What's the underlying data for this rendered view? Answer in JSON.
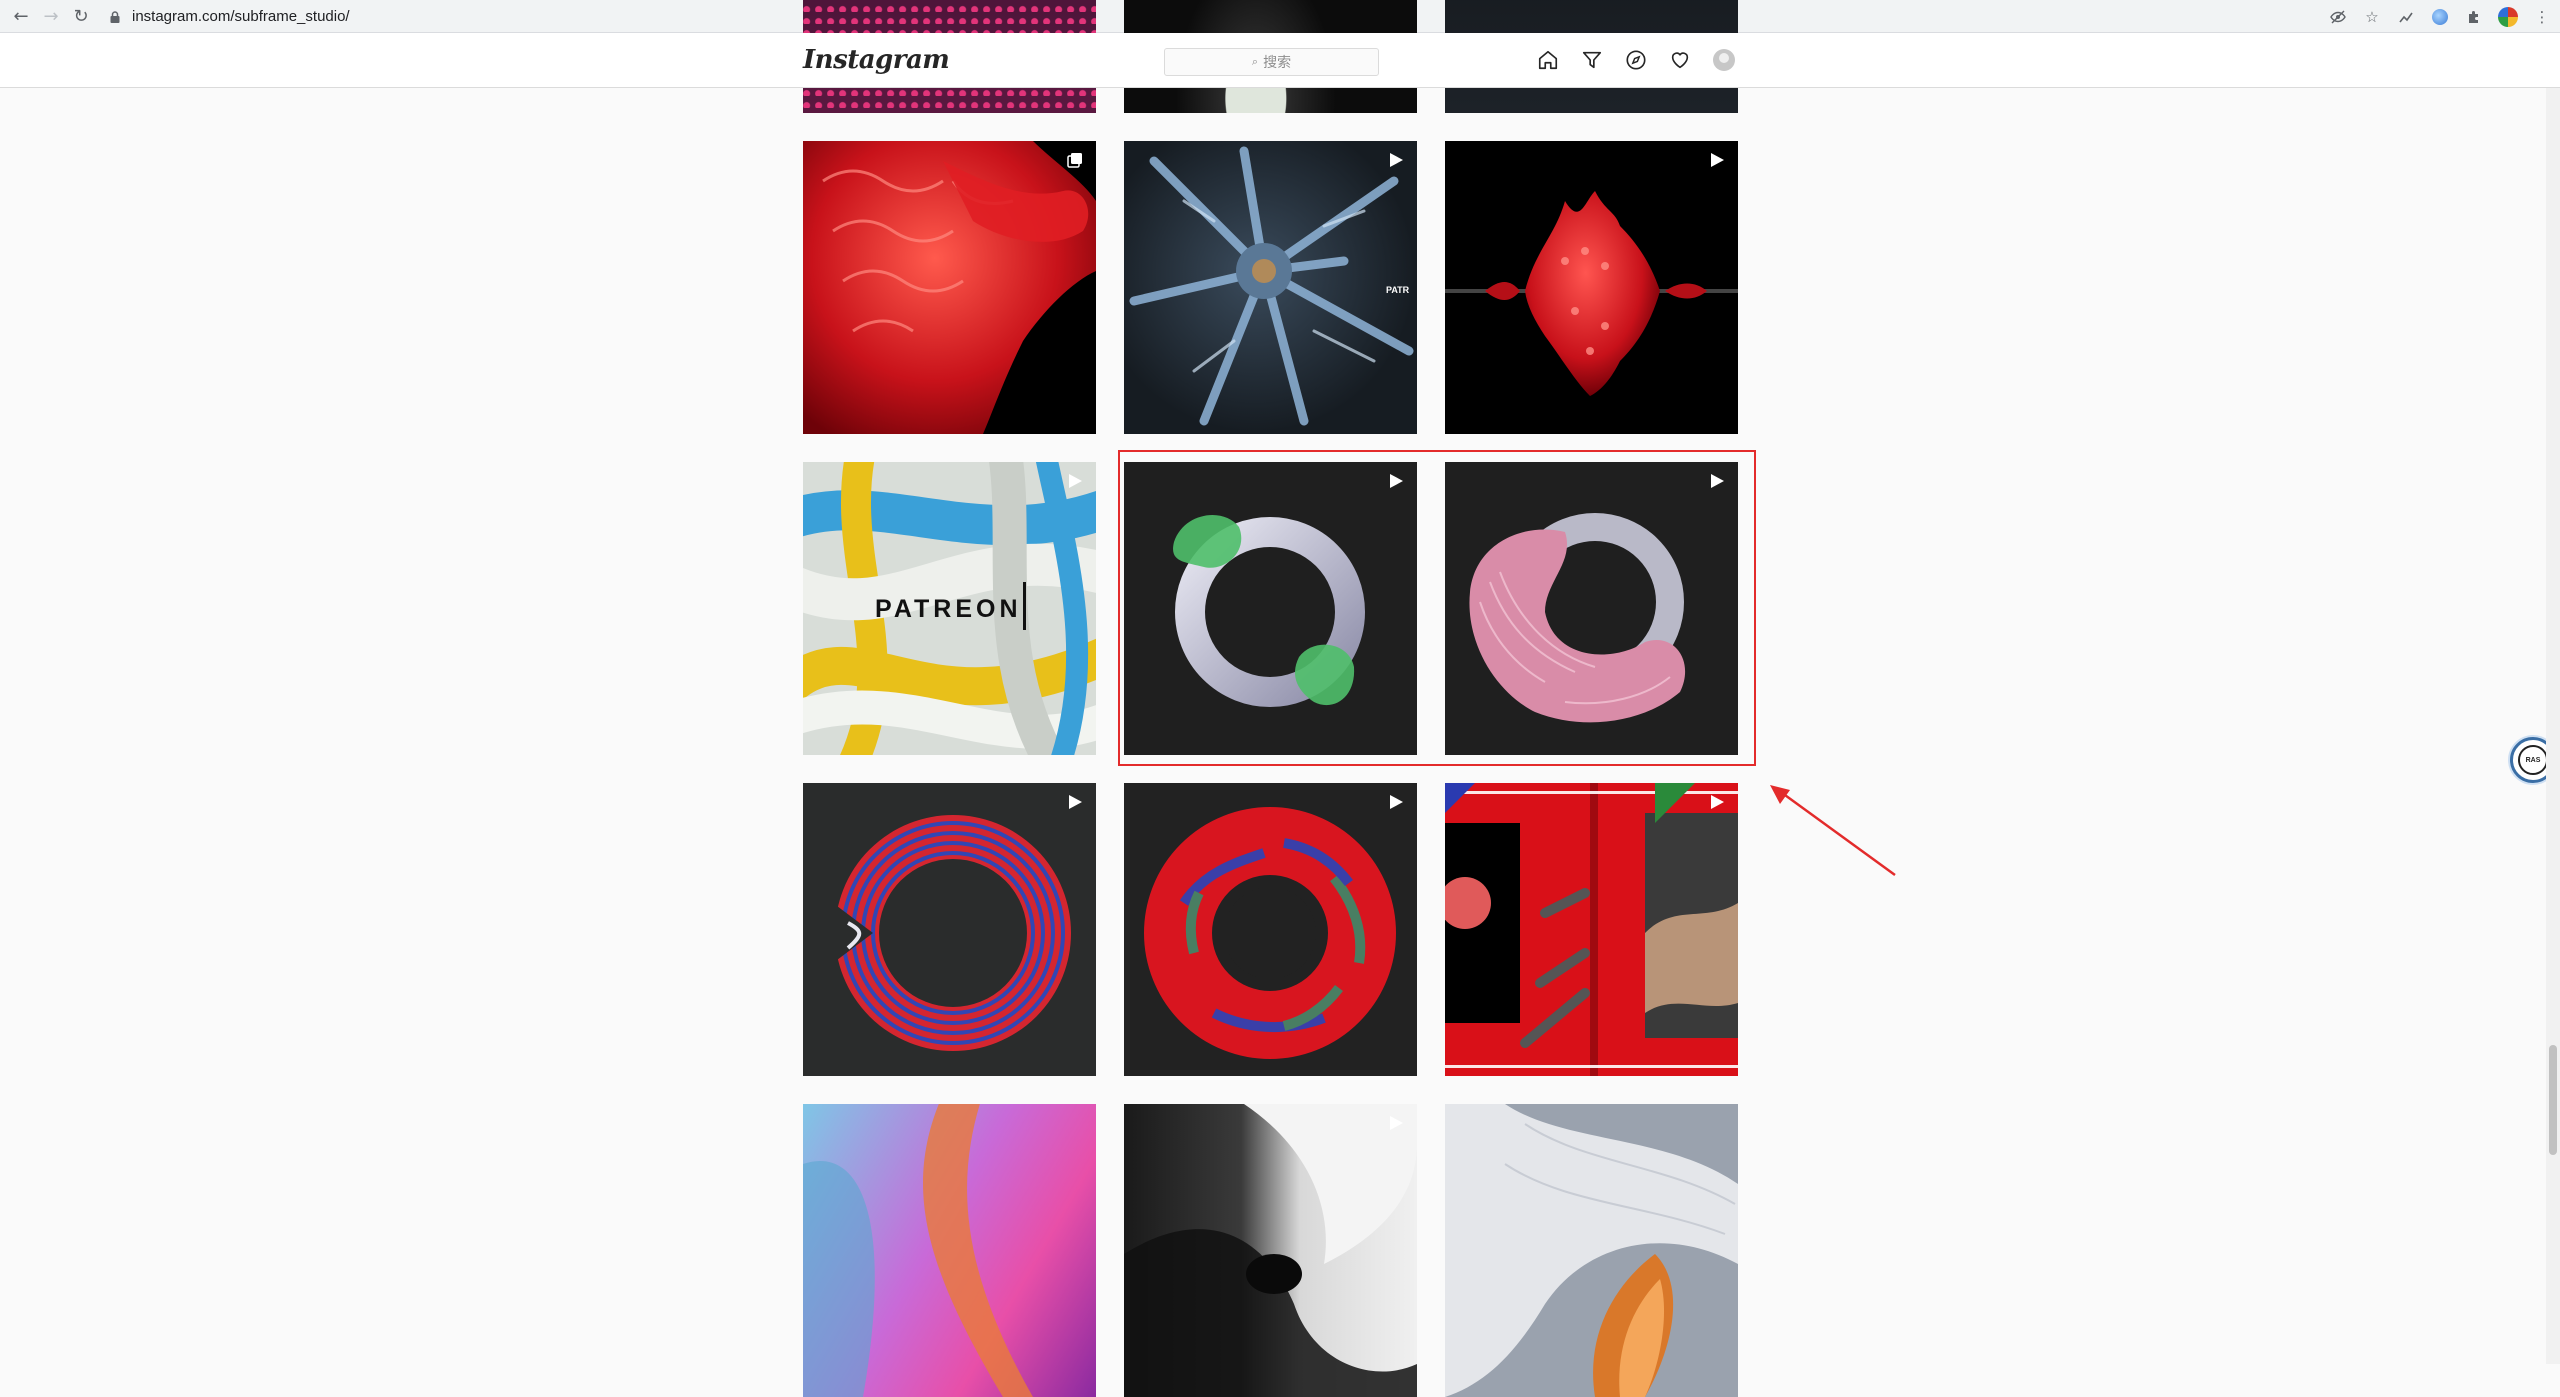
{
  "browser": {
    "url": "instagram.com/subframe_studio/",
    "icons": [
      "back-icon",
      "forward-icon",
      "reload-icon",
      "lock-icon",
      "eye-off-icon",
      "star-icon",
      "extension-icon",
      "globe-icon",
      "puzzle-icon",
      "profile-icon",
      "menu-icon"
    ]
  },
  "instagram": {
    "logo": "Instagram",
    "search_placeholder": "搜索",
    "nav_icons": [
      "home-icon",
      "direct-icon",
      "explore-icon",
      "heart-icon",
      "profile-avatar"
    ]
  },
  "patreon_text": "PATREON",
  "patreon_small_text": "PATR",
  "widget_text": "RAS",
  "posts": [
    {
      "name": "post-top-left-partial",
      "badge": "none"
    },
    {
      "name": "post-top-middle-partial",
      "badge": "none"
    },
    {
      "name": "post-top-right-partial",
      "badge": "none"
    },
    {
      "name": "post-red-coral-sculpture",
      "badge": "carousel"
    },
    {
      "name": "post-blue-crystal-tree",
      "badge": "video"
    },
    {
      "name": "post-red-spiky-form",
      "badge": "video"
    },
    {
      "name": "post-patreon-tubes",
      "badge": "video"
    },
    {
      "name": "post-ring-green-blobs",
      "badge": "video"
    },
    {
      "name": "post-ring-pink-frills",
      "badge": "video"
    },
    {
      "name": "post-red-blue-striped-ring",
      "badge": "video"
    },
    {
      "name": "post-marbled-donut",
      "badge": "video"
    },
    {
      "name": "post-red-collage",
      "badge": "video"
    },
    {
      "name": "post-pink-glass-swirl",
      "badge": "none"
    },
    {
      "name": "post-black-white-vortex",
      "badge": "video"
    },
    {
      "name": "post-white-orange-spiral",
      "badge": "none"
    }
  ]
}
